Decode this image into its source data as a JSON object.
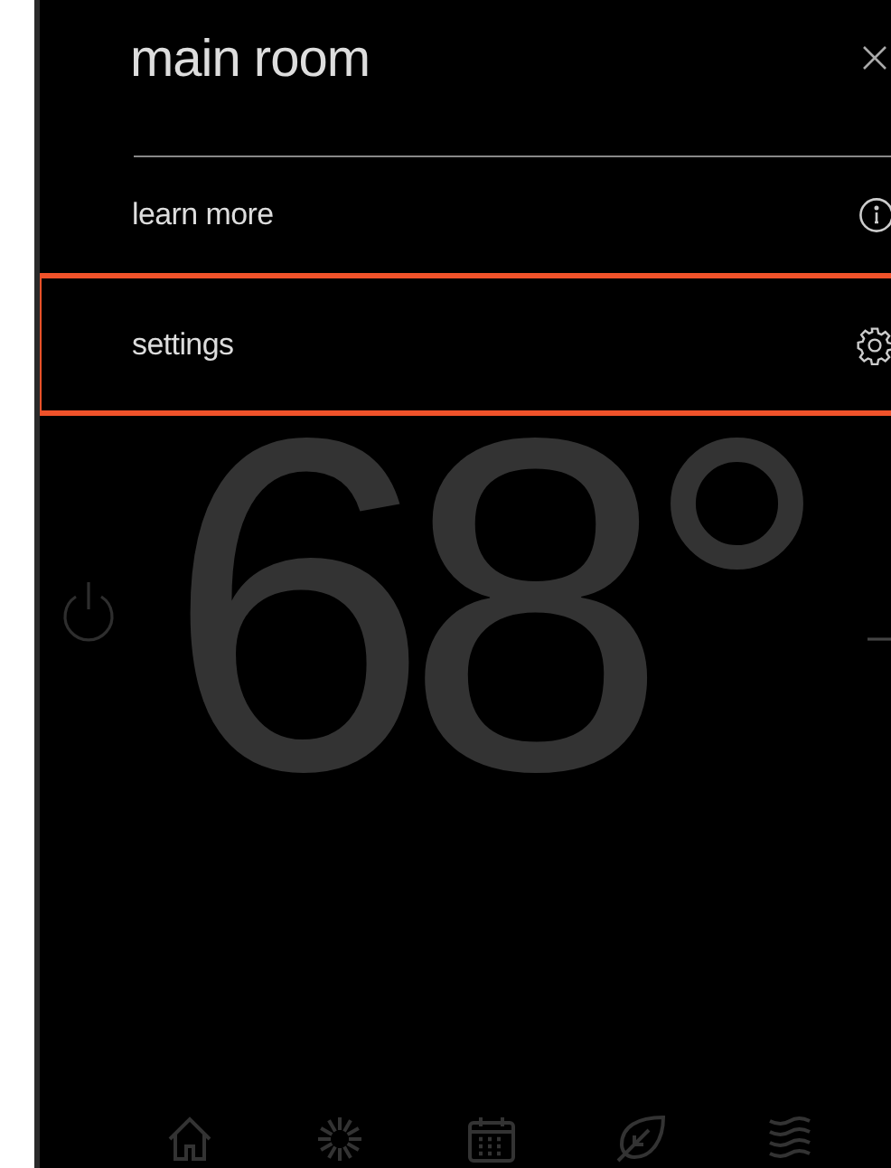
{
  "header": {
    "title": "main room"
  },
  "menu": [
    {
      "label": "learn more",
      "kind": "info",
      "selected": false
    },
    {
      "label": "settings",
      "kind": "gear",
      "selected": true
    }
  ],
  "thermostat": {
    "temperature": "68°"
  },
  "nav": [
    {
      "kind": "home"
    },
    {
      "kind": "sun"
    },
    {
      "kind": "calendar"
    },
    {
      "kind": "leaf"
    },
    {
      "kind": "waves"
    }
  ]
}
